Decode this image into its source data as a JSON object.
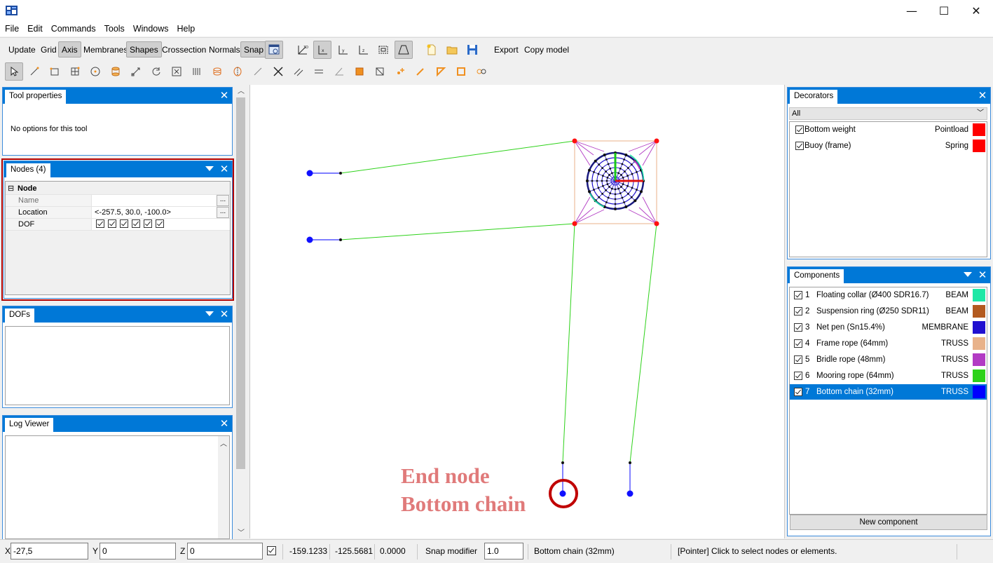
{
  "window": {
    "minimize_glyph": "—",
    "maximize_glyph": "☐",
    "close_glyph": "✕"
  },
  "menu": [
    "File",
    "Edit",
    "Commands",
    "Tools",
    "Windows",
    "Help"
  ],
  "toolbar1": {
    "buttons": [
      {
        "label": "Update",
        "active": false
      },
      {
        "label": "Grid",
        "active": false
      },
      {
        "label": "Axis",
        "active": true
      },
      {
        "label": "Membranes",
        "active": false
      },
      {
        "label": "Shapes",
        "active": true
      },
      {
        "label": "Crossection",
        "active": false
      },
      {
        "label": "Normals",
        "active": false
      },
      {
        "label": "Snap",
        "active": true
      }
    ],
    "export_label": "Export",
    "copy_model_label": "Copy model"
  },
  "tool_properties": {
    "title": "Tool properties",
    "message": "No options for this tool"
  },
  "nodes_panel": {
    "title": "Nodes (4)",
    "category": "Node",
    "category_toggle": "⊟",
    "rows": [
      {
        "label": "Name",
        "value": "",
        "ellipsis": "..."
      },
      {
        "label": "Location",
        "value": "<-257.5, 30.0, -100.0>",
        "ellipsis": "..."
      },
      {
        "label": "DOF",
        "checked_count": 6
      }
    ]
  },
  "dofs_panel": {
    "title": "DOFs"
  },
  "log_panel": {
    "title": "Log Viewer"
  },
  "decorators": {
    "title": "Decorators",
    "filter": "All",
    "items": [
      {
        "label": "Bottom weight",
        "type": "Pointload",
        "color": "#ff0000"
      },
      {
        "label": "Buoy (frame)",
        "type": "Spring",
        "color": "#ff0000"
      }
    ]
  },
  "components": {
    "title": "Components",
    "items": [
      {
        "num": "1",
        "label": "Floating collar (Ø400 SDR16.7)",
        "type": "BEAM",
        "color": "#1ee8a6"
      },
      {
        "num": "2",
        "label": "Suspension ring (Ø250 SDR11)",
        "type": "BEAM",
        "color": "#b35a1f"
      },
      {
        "num": "3",
        "label": "Net pen (Sn15.4%)",
        "type": "MEMBRANE",
        "color": "#2010d0"
      },
      {
        "num": "4",
        "label": "Frame rope (64mm)",
        "type": "TRUSS",
        "color": "#e8b28a"
      },
      {
        "num": "5",
        "label": "Bridle rope (48mm)",
        "type": "TRUSS",
        "color": "#b23bc4"
      },
      {
        "num": "6",
        "label": "Mooring rope (64mm)",
        "type": "TRUSS",
        "color": "#2ed21a"
      },
      {
        "num": "7",
        "label": "Bottom chain (32mm)",
        "type": "TRUSS",
        "color": "#0000ff",
        "selected": true
      }
    ],
    "new_button": "New component"
  },
  "canvas": {
    "annotation_line1": "End node",
    "annotation_line2": "Bottom chain",
    "annotation_color": "#e07a7a",
    "highlight_color": "#c00000"
  },
  "statusbar": {
    "x_label": "X",
    "x_value": "-27,5",
    "y_label": "Y",
    "y_value": "0",
    "z_label": "Z",
    "z_value": "0",
    "coord1": "-159.1233",
    "coord2": "-125.5681",
    "coord3": "0.0000",
    "snap_label": "Snap modifier",
    "snap_value": "1.0",
    "current_component": "Bottom chain (32mm)",
    "hint": "[Pointer] Click to select nodes or elements."
  }
}
